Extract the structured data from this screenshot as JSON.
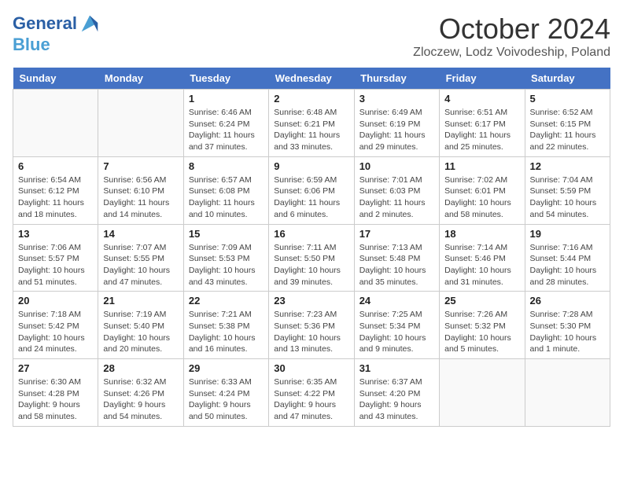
{
  "header": {
    "logo_line1": "General",
    "logo_line2": "Blue",
    "month": "October 2024",
    "location": "Zloczew, Lodz Voivodeship, Poland"
  },
  "weekdays": [
    "Sunday",
    "Monday",
    "Tuesday",
    "Wednesday",
    "Thursday",
    "Friday",
    "Saturday"
  ],
  "weeks": [
    [
      {
        "day": "",
        "sunrise": "",
        "sunset": "",
        "daylight": ""
      },
      {
        "day": "",
        "sunrise": "",
        "sunset": "",
        "daylight": ""
      },
      {
        "day": "1",
        "sunrise": "Sunrise: 6:46 AM",
        "sunset": "Sunset: 6:24 PM",
        "daylight": "Daylight: 11 hours and 37 minutes."
      },
      {
        "day": "2",
        "sunrise": "Sunrise: 6:48 AM",
        "sunset": "Sunset: 6:21 PM",
        "daylight": "Daylight: 11 hours and 33 minutes."
      },
      {
        "day": "3",
        "sunrise": "Sunrise: 6:49 AM",
        "sunset": "Sunset: 6:19 PM",
        "daylight": "Daylight: 11 hours and 29 minutes."
      },
      {
        "day": "4",
        "sunrise": "Sunrise: 6:51 AM",
        "sunset": "Sunset: 6:17 PM",
        "daylight": "Daylight: 11 hours and 25 minutes."
      },
      {
        "day": "5",
        "sunrise": "Sunrise: 6:52 AM",
        "sunset": "Sunset: 6:15 PM",
        "daylight": "Daylight: 11 hours and 22 minutes."
      }
    ],
    [
      {
        "day": "6",
        "sunrise": "Sunrise: 6:54 AM",
        "sunset": "Sunset: 6:12 PM",
        "daylight": "Daylight: 11 hours and 18 minutes."
      },
      {
        "day": "7",
        "sunrise": "Sunrise: 6:56 AM",
        "sunset": "Sunset: 6:10 PM",
        "daylight": "Daylight: 11 hours and 14 minutes."
      },
      {
        "day": "8",
        "sunrise": "Sunrise: 6:57 AM",
        "sunset": "Sunset: 6:08 PM",
        "daylight": "Daylight: 11 hours and 10 minutes."
      },
      {
        "day": "9",
        "sunrise": "Sunrise: 6:59 AM",
        "sunset": "Sunset: 6:06 PM",
        "daylight": "Daylight: 11 hours and 6 minutes."
      },
      {
        "day": "10",
        "sunrise": "Sunrise: 7:01 AM",
        "sunset": "Sunset: 6:03 PM",
        "daylight": "Daylight: 11 hours and 2 minutes."
      },
      {
        "day": "11",
        "sunrise": "Sunrise: 7:02 AM",
        "sunset": "Sunset: 6:01 PM",
        "daylight": "Daylight: 10 hours and 58 minutes."
      },
      {
        "day": "12",
        "sunrise": "Sunrise: 7:04 AM",
        "sunset": "Sunset: 5:59 PM",
        "daylight": "Daylight: 10 hours and 54 minutes."
      }
    ],
    [
      {
        "day": "13",
        "sunrise": "Sunrise: 7:06 AM",
        "sunset": "Sunset: 5:57 PM",
        "daylight": "Daylight: 10 hours and 51 minutes."
      },
      {
        "day": "14",
        "sunrise": "Sunrise: 7:07 AM",
        "sunset": "Sunset: 5:55 PM",
        "daylight": "Daylight: 10 hours and 47 minutes."
      },
      {
        "day": "15",
        "sunrise": "Sunrise: 7:09 AM",
        "sunset": "Sunset: 5:53 PM",
        "daylight": "Daylight: 10 hours and 43 minutes."
      },
      {
        "day": "16",
        "sunrise": "Sunrise: 7:11 AM",
        "sunset": "Sunset: 5:50 PM",
        "daylight": "Daylight: 10 hours and 39 minutes."
      },
      {
        "day": "17",
        "sunrise": "Sunrise: 7:13 AM",
        "sunset": "Sunset: 5:48 PM",
        "daylight": "Daylight: 10 hours and 35 minutes."
      },
      {
        "day": "18",
        "sunrise": "Sunrise: 7:14 AM",
        "sunset": "Sunset: 5:46 PM",
        "daylight": "Daylight: 10 hours and 31 minutes."
      },
      {
        "day": "19",
        "sunrise": "Sunrise: 7:16 AM",
        "sunset": "Sunset: 5:44 PM",
        "daylight": "Daylight: 10 hours and 28 minutes."
      }
    ],
    [
      {
        "day": "20",
        "sunrise": "Sunrise: 7:18 AM",
        "sunset": "Sunset: 5:42 PM",
        "daylight": "Daylight: 10 hours and 24 minutes."
      },
      {
        "day": "21",
        "sunrise": "Sunrise: 7:19 AM",
        "sunset": "Sunset: 5:40 PM",
        "daylight": "Daylight: 10 hours and 20 minutes."
      },
      {
        "day": "22",
        "sunrise": "Sunrise: 7:21 AM",
        "sunset": "Sunset: 5:38 PM",
        "daylight": "Daylight: 10 hours and 16 minutes."
      },
      {
        "day": "23",
        "sunrise": "Sunrise: 7:23 AM",
        "sunset": "Sunset: 5:36 PM",
        "daylight": "Daylight: 10 hours and 13 minutes."
      },
      {
        "day": "24",
        "sunrise": "Sunrise: 7:25 AM",
        "sunset": "Sunset: 5:34 PM",
        "daylight": "Daylight: 10 hours and 9 minutes."
      },
      {
        "day": "25",
        "sunrise": "Sunrise: 7:26 AM",
        "sunset": "Sunset: 5:32 PM",
        "daylight": "Daylight: 10 hours and 5 minutes."
      },
      {
        "day": "26",
        "sunrise": "Sunrise: 7:28 AM",
        "sunset": "Sunset: 5:30 PM",
        "daylight": "Daylight: 10 hours and 1 minute."
      }
    ],
    [
      {
        "day": "27",
        "sunrise": "Sunrise: 6:30 AM",
        "sunset": "Sunset: 4:28 PM",
        "daylight": "Daylight: 9 hours and 58 minutes."
      },
      {
        "day": "28",
        "sunrise": "Sunrise: 6:32 AM",
        "sunset": "Sunset: 4:26 PM",
        "daylight": "Daylight: 9 hours and 54 minutes."
      },
      {
        "day": "29",
        "sunrise": "Sunrise: 6:33 AM",
        "sunset": "Sunset: 4:24 PM",
        "daylight": "Daylight: 9 hours and 50 minutes."
      },
      {
        "day": "30",
        "sunrise": "Sunrise: 6:35 AM",
        "sunset": "Sunset: 4:22 PM",
        "daylight": "Daylight: 9 hours and 47 minutes."
      },
      {
        "day": "31",
        "sunrise": "Sunrise: 6:37 AM",
        "sunset": "Sunset: 4:20 PM",
        "daylight": "Daylight: 9 hours and 43 minutes."
      },
      {
        "day": "",
        "sunrise": "",
        "sunset": "",
        "daylight": ""
      },
      {
        "day": "",
        "sunrise": "",
        "sunset": "",
        "daylight": ""
      }
    ]
  ]
}
